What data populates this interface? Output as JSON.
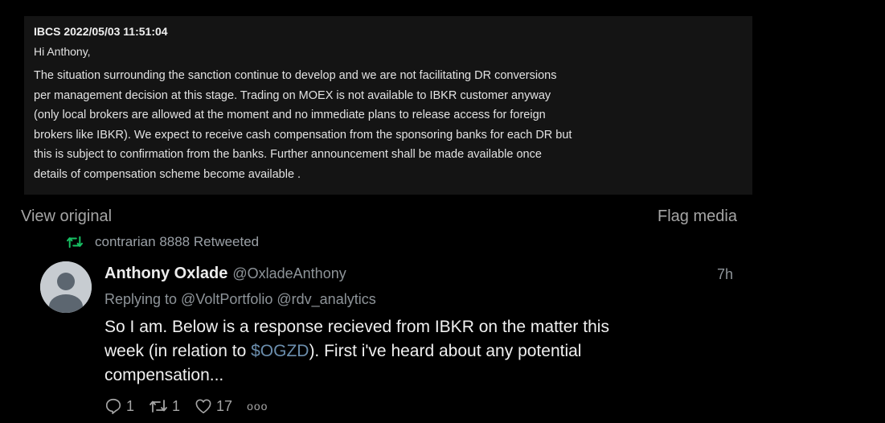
{
  "media": {
    "header": "IBCS 2022/05/03 11:51:04",
    "greeting": "Hi Anthony,",
    "lines": [
      "The situation surrounding the sanction continue to develop and we are not facilitating DR conversions",
      "per management decision at this stage. Trading on MOEX is not available to IBKR customer anyway",
      "(only local brokers are allowed at the moment and no immediate plans to release access for foreign",
      "brokers like IBKR). We expect to receive cash compensation from the sponsoring banks for each DR but",
      "this is subject to confirmation from the banks. Further announcement shall be made available once",
      "details of compensation scheme become available ."
    ]
  },
  "links": {
    "view_original": "View original",
    "flag_media": "Flag media"
  },
  "retweet": {
    "text": "contrarian 8888 Retweeted",
    "icon": "retweet-icon",
    "color": "#17bf63"
  },
  "tweet": {
    "author_name": "Anthony Oxlade",
    "author_handle": "@OxladeAnthony",
    "timestamp": "7h",
    "replying_to": "Replying to @VoltPortfolio @rdv_analytics",
    "text": {
      "line1": "So I am. Below is a response recieved from IBKR on the matter this",
      "line2_before": "week (in relation to ",
      "cashtag": "$OGZD",
      "line2_after": "). First i've heard about any potential",
      "line3": "compensation..."
    },
    "cashtag_color": "#6b8ead"
  },
  "actions": {
    "reply_count": "1",
    "retweet_count": "1",
    "like_count": "17",
    "more": "ooo"
  }
}
